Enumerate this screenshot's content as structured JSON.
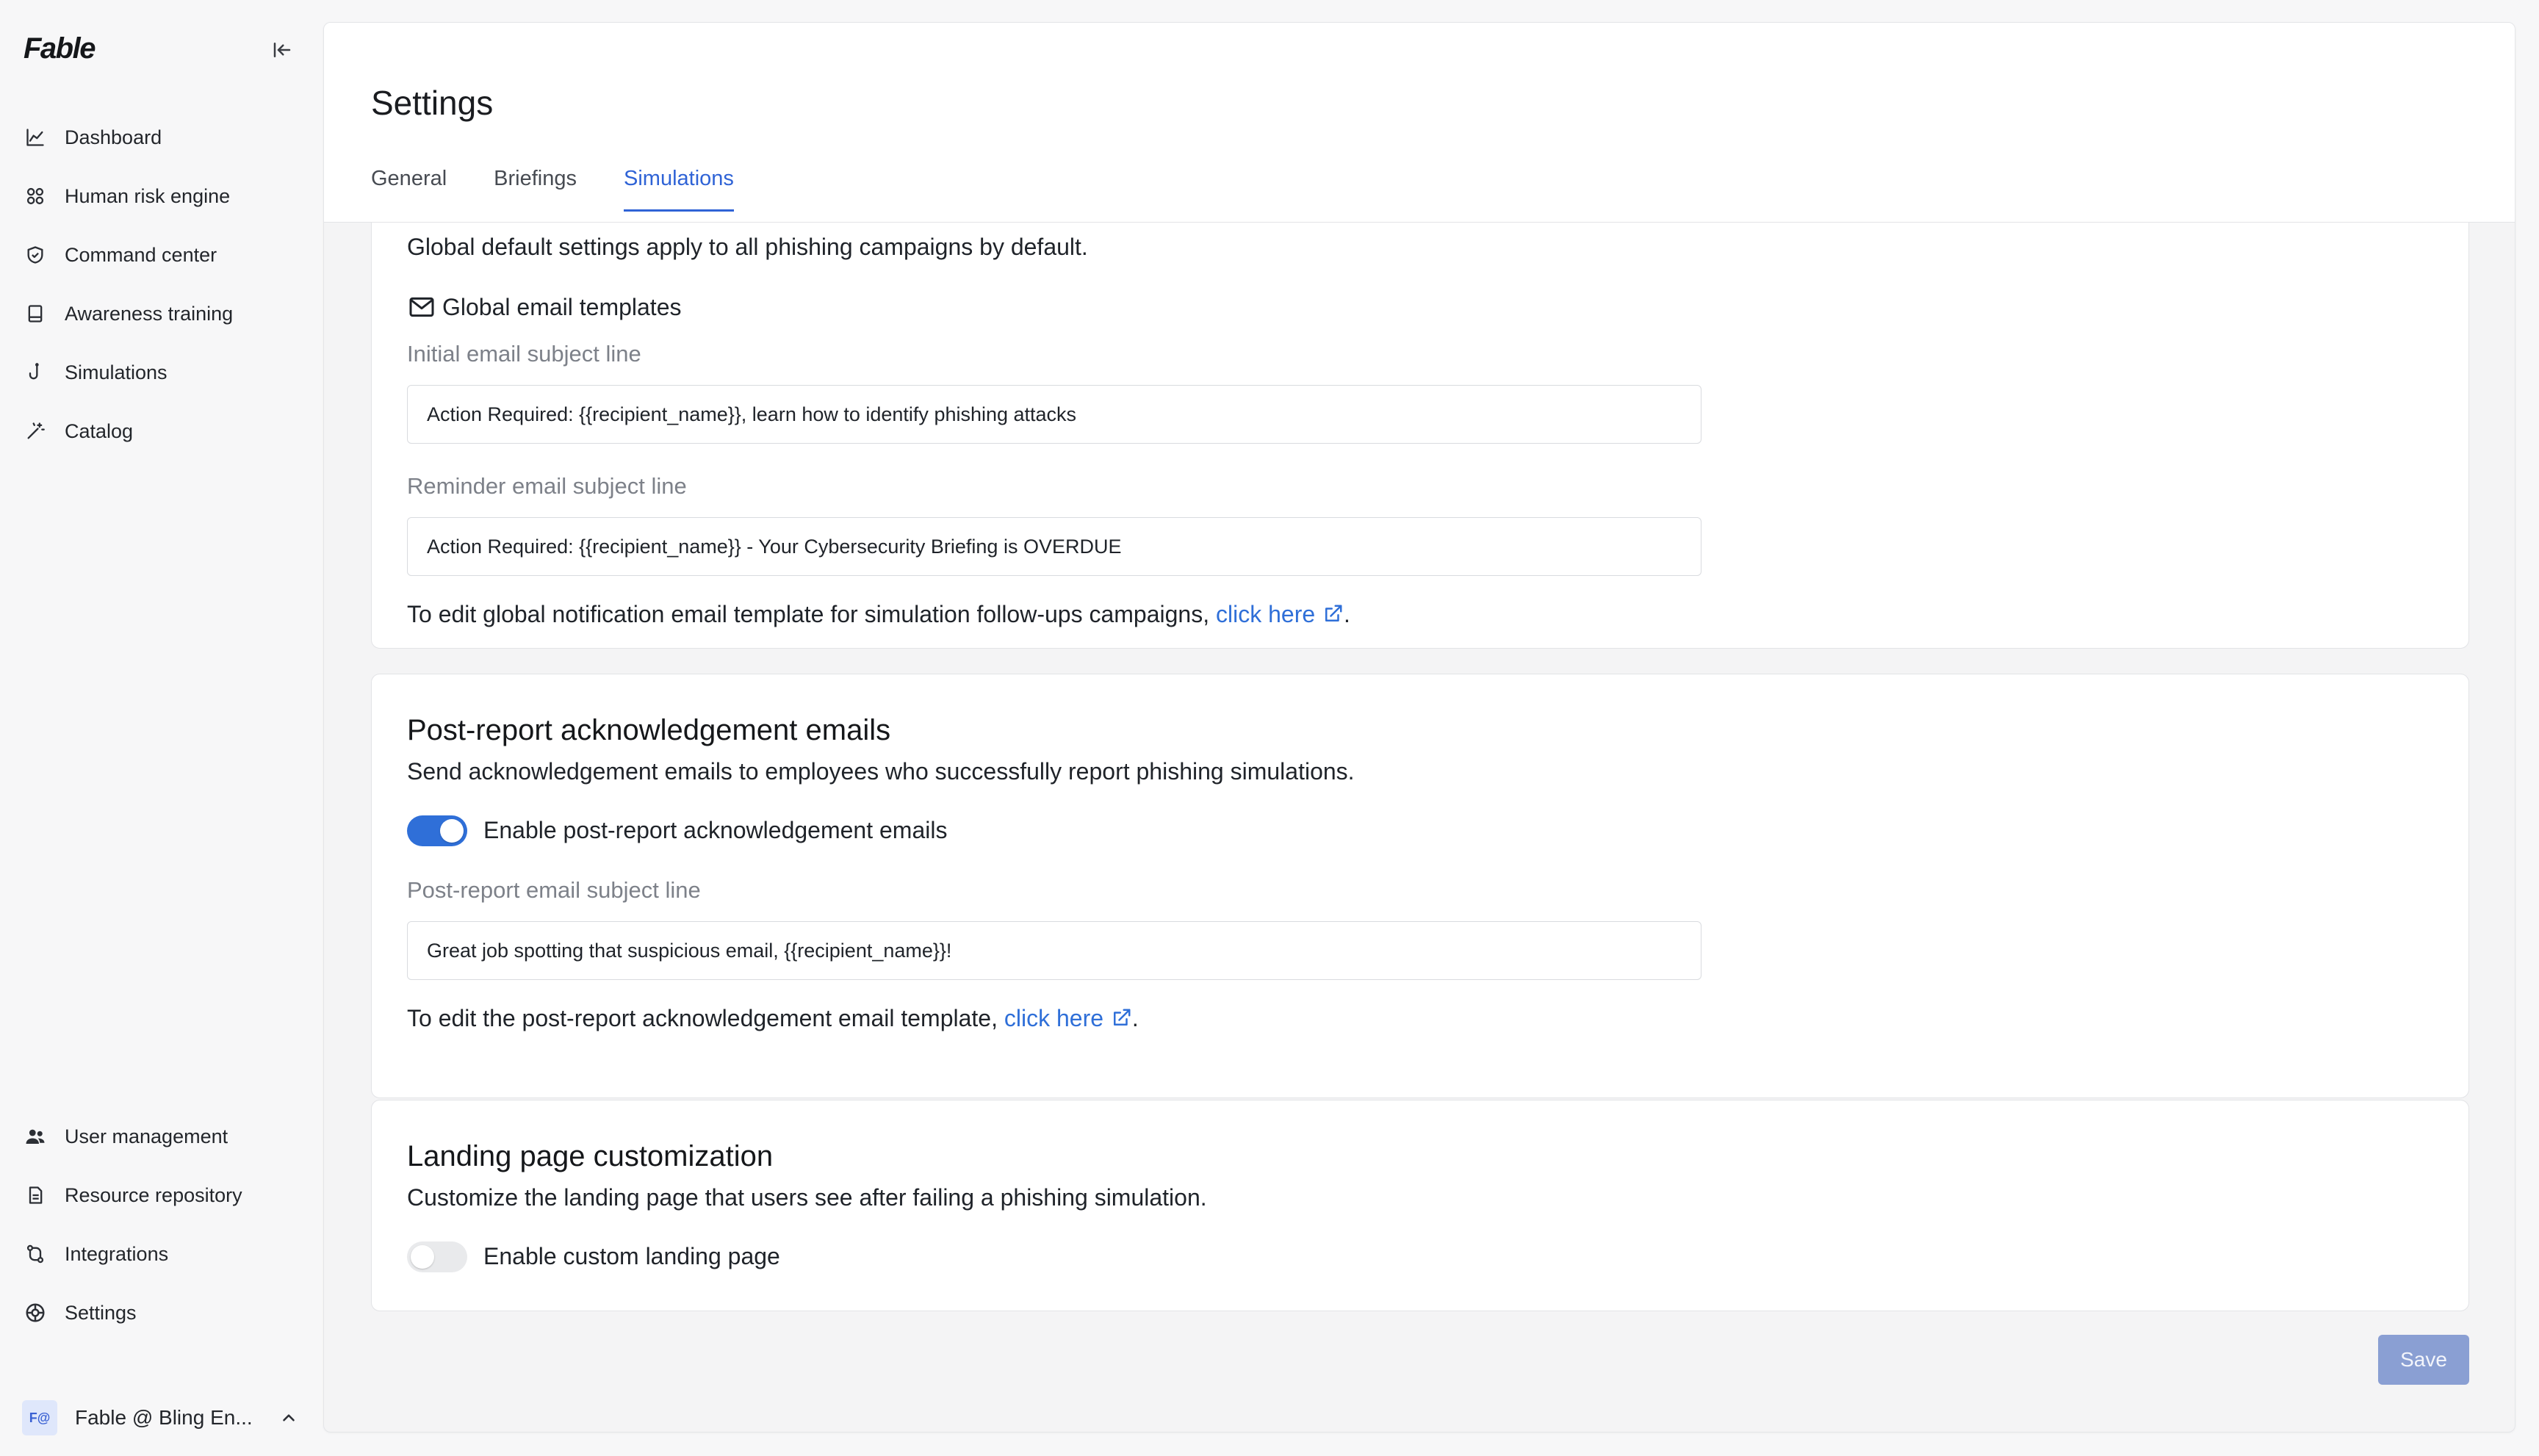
{
  "brand": "Fable",
  "sidebar": {
    "nav": [
      {
        "label": "Dashboard",
        "icon": "chart-line-icon"
      },
      {
        "label": "Human risk engine",
        "icon": "network-icon"
      },
      {
        "label": "Command center",
        "icon": "shield-check-icon"
      },
      {
        "label": "Awareness training",
        "icon": "book-icon"
      },
      {
        "label": "Simulations",
        "icon": "hook-icon"
      },
      {
        "label": "Catalog",
        "icon": "magic-wand-icon"
      }
    ],
    "bottom_nav": [
      {
        "label": "User management",
        "icon": "users-icon"
      },
      {
        "label": "Resource repository",
        "icon": "document-icon"
      },
      {
        "label": "Integrations",
        "icon": "git-branch-icon"
      },
      {
        "label": "Settings",
        "icon": "settings-icon"
      }
    ],
    "account": {
      "avatar": "F@",
      "name": "Fable @ Bling En..."
    }
  },
  "header": {
    "title": "Settings",
    "tabs": [
      {
        "label": "General",
        "active": false
      },
      {
        "label": "Briefings",
        "active": false
      },
      {
        "label": "Simulations",
        "active": true
      }
    ]
  },
  "global_card": {
    "partial_text": "Global default settings apply to all phishing campaigns by default.",
    "section_heading": "Global email templates",
    "initial_label": "Initial email subject line",
    "initial_value": "Action Required: {{recipient_name}}, learn how to identify phishing attacks",
    "reminder_label": "Reminder email subject line",
    "reminder_value": "Action Required: {{recipient_name}} - Your Cybersecurity Briefing is OVERDUE",
    "edit_text": "To edit global notification email template for simulation follow-ups campaigns,",
    "edit_link": "click here",
    "edit_end": "."
  },
  "post_report_card": {
    "title": "Post-report acknowledgement emails",
    "description": "Send acknowledgement emails to employees who successfully report phishing simulations.",
    "toggle_label": "Enable post-report acknowledgement emails",
    "toggle_on": true,
    "subject_label": "Post-report email subject line",
    "subject_value": "Great job spotting that suspicious email, {{recipient_name}}!",
    "edit_text": "To edit the post-report acknowledgement email template,",
    "edit_link": "click here",
    "edit_end": "."
  },
  "landing_card": {
    "title": "Landing page customization",
    "description": "Customize the landing page that users see after failing a phishing simulation.",
    "toggle_label": "Enable custom landing page",
    "toggle_on": false
  },
  "save_label": "Save",
  "colors": {
    "accent": "#2f6fd8",
    "save_disabled": "#8a9fd3"
  }
}
